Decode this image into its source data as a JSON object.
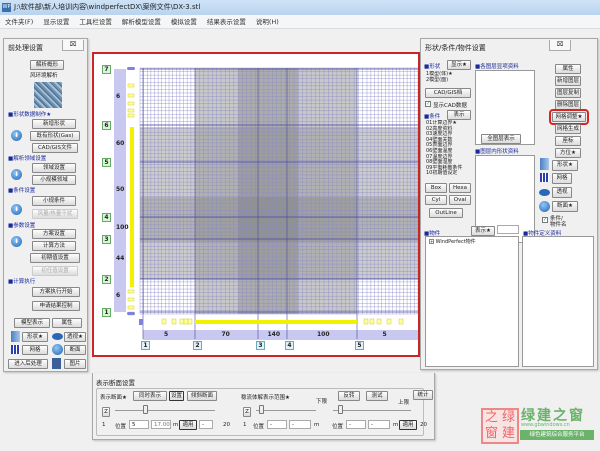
{
  "window": {
    "title": "J:\\软件部\\新人培训内容\\windperfectDX\\案例文件\\DX-3.stl",
    "icon": "WP"
  },
  "menu": [
    "文件夹(F)",
    "显示设置",
    "工具栏设置",
    "解析模型设置",
    "模拟设置",
    "结果表示设置",
    "说明(H)"
  ],
  "left_panel": {
    "title": "前处理设置",
    "close": "⌧",
    "analysis_button": "解析概形",
    "analysis_type": "风环境解析",
    "sections": {
      "shape": "形状数据制作★",
      "domain": "解析领域设置",
      "condition": "条件设置",
      "param": "参数设置",
      "exec": "计算执行"
    },
    "buttons": {
      "new_shape": "新增形状",
      "existing_shape": "既有形状(Gas)",
      "cad_gis": "CAD/GIS文件",
      "domain_set": "领域设置",
      "small_domain": "小规模领域",
      "small_cond": "小规条件",
      "wind_heat": "风量/热量干扰",
      "scheme": "方案设置",
      "calc_method": "计算方法",
      "init_value": "初期值设置",
      "init_value2": "初任值设置",
      "run_start": "方案执行开始",
      "result_ctrl": "申请结果控制",
      "model_view": "模型表示",
      "props": "属性",
      "shape_star": "形状★",
      "perspective": "透视★",
      "mesh": "网格",
      "section": "断面",
      "post": "进入后处理",
      "image": "图片"
    }
  },
  "canvas": {
    "v_labels": [
      "7",
      "6",
      "5",
      "4",
      "3",
      "2",
      "1"
    ],
    "v_spans": [
      "6",
      "60",
      "50",
      "100",
      "44",
      "6"
    ],
    "h_labels": [
      "1",
      "2",
      "3",
      "4",
      "5"
    ],
    "h_spans": [
      "5",
      "70",
      "140",
      "100",
      "5"
    ]
  },
  "right_panel": {
    "title": "形状/条件/物件设置",
    "close": "⌧",
    "shape_label": "形状",
    "show_star": "显示★",
    "layer_info": "各图层显项资料",
    "shape_list": [
      "1模型(体)★",
      "2模型(面)"
    ],
    "cad_gis": "CAD/GIS档",
    "show_cad": "显示CAD数据",
    "cond_label": "条件",
    "cond_show": "表示",
    "cond_list": [
      "01计算边界★",
      "02高度资料",
      "03速度边界",
      "04壁面关数",
      "05表面边界",
      "06壁面温度",
      "07温度边界",
      "08壁面湿度",
      "09平衡耗散条件",
      "10初期值设定"
    ],
    "all_layers": "全图层表示",
    "layer_shape_info": "图层内形状资料",
    "side_buttons": [
      "属性",
      "新增图层",
      "图层复制",
      "删除图层",
      "网格调整★",
      "网格生成",
      "座标",
      "方位★"
    ],
    "prims": [
      "Box",
      "Hexa",
      "Cyl",
      "Oval",
      "OutLine"
    ],
    "view_buttons": [
      "形状★",
      "网格",
      "透视",
      "断面★"
    ],
    "cond_obj_name": "条件/物件名",
    "obj_label": "物件",
    "obj_show": "表示★",
    "obj_def": "物件定义资料",
    "obj_tree": "WindPerfect物件"
  },
  "bottom_panel": {
    "title": "表示断面设置",
    "section_label": "表示断面★",
    "simul": "同时表示",
    "setting": "设置",
    "tilted": "倾斜断面",
    "range_label": "稳流体解表示范围★",
    "lower": "下限",
    "upper": "上限",
    "reverse": "反转",
    "test": "测试",
    "stats": "统计",
    "axis": "Z",
    "axis2": "Z",
    "min1": "1",
    "pos": "位置",
    "pos_val": "5",
    "pos_m": "17.00",
    "unit": "m",
    "apply": "適用",
    "dash": "-",
    "max1": "20",
    "min2": "1",
    "max2": "20"
  },
  "watermark": {
    "seal": "之绿窗建",
    "name": "绿建之窗",
    "url": "www.gbwindows.cn",
    "slogan": "绿色建筑综合服务平台"
  }
}
